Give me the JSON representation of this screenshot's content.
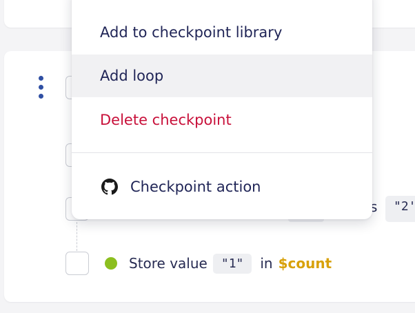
{
  "menu": {
    "items": [
      {
        "label": "Add to checkpoint library"
      },
      {
        "label": "Add loop"
      },
      {
        "label": "Delete checkpoint"
      }
    ],
    "action": {
      "label": "Checkpoint action",
      "icon": "github-icon"
    }
  },
  "step": {
    "status_color": "#8cbf1f",
    "verb": "Store value",
    "value": "\"1\"",
    "preposition": "in",
    "variable": "$count",
    "variable_color": "#d8a10a"
  },
  "partial_step": {
    "text_fragment": "s",
    "value_fragment": "\"2'"
  },
  "colors": {
    "accent": "#2f4fa3",
    "danger": "#c8103a"
  }
}
